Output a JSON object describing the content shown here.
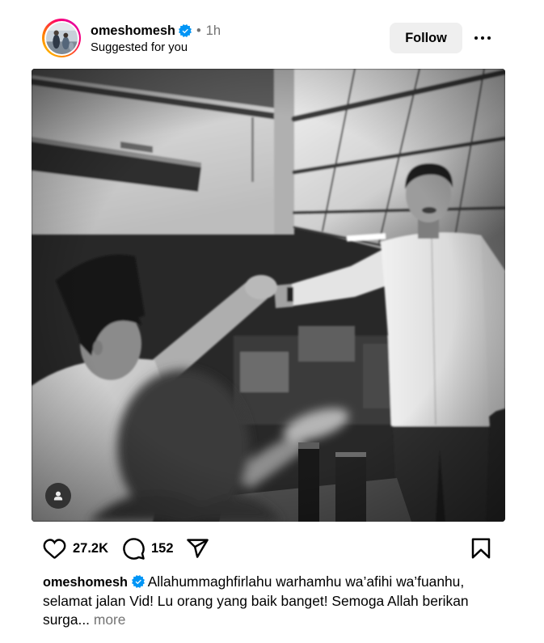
{
  "post": {
    "author": {
      "username": "omeshomesh",
      "verified": true,
      "separator": "•",
      "time": "1h",
      "subtitle": "Suggested for you"
    },
    "follow_label": "Follow",
    "actions": {
      "likes": "27.2K",
      "comments": "152"
    },
    "caption": {
      "username": "omeshomesh",
      "verified": true,
      "text": "Allahummaghfirlahu warhamhu wa’afihi wa’fuanhu, selamat jalan Vid! Lu orang yang baik banget! Semoga Allah berikan surga...",
      "more_label": "more"
    }
  },
  "icons": {
    "avatar": "avatar-story-ring",
    "verified": "verified-badge-icon",
    "options": "more-options-icon",
    "tag": "user-tag-icon",
    "like": "heart-icon",
    "comment": "comment-icon",
    "share": "share-icon",
    "save": "bookmark-icon"
  },
  "colors": {
    "background": "#FFFFFF",
    "text": "#000000",
    "secondary_text": "#737373",
    "verified_blue": "#0095F6",
    "follow_button_bg": "#EFEFEF",
    "tag_button_bg": "#262626",
    "story_ring": [
      "#FFD600",
      "#FF7A00",
      "#FF0069",
      "#D300C5"
    ]
  }
}
